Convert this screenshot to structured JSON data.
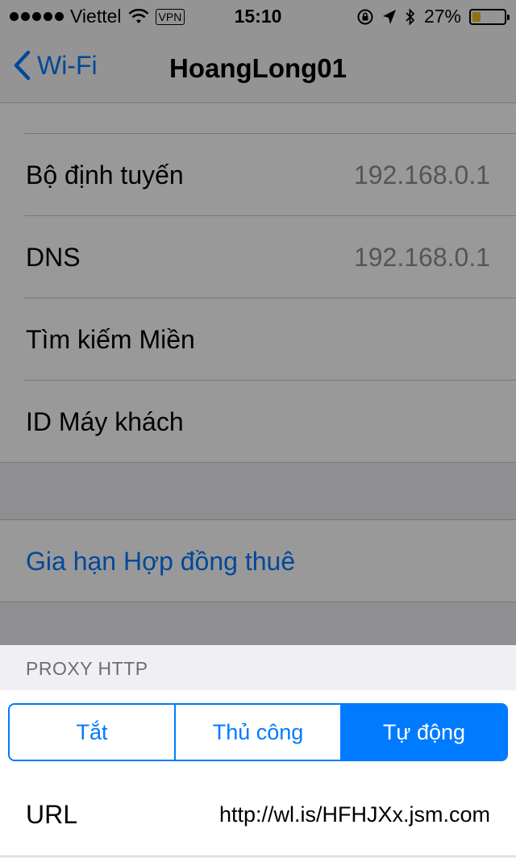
{
  "status_bar": {
    "carrier": "Viettel",
    "vpn": "VPN",
    "time": "15:10",
    "battery": "27%",
    "battery_level": 0.27
  },
  "nav": {
    "back_label": "Wi-Fi",
    "title": "HoangLong01"
  },
  "rows": [
    {
      "label": "Bộ định tuyến",
      "value": "192.168.0.1"
    },
    {
      "label": "DNS",
      "value": "192.168.0.1"
    },
    {
      "label": "Tìm kiếm Miền",
      "value": ""
    },
    {
      "label": "ID Máy khách",
      "value": ""
    }
  ],
  "renew_lease": "Gia hạn Hợp đồng thuê",
  "proxy": {
    "header": "PROXY HTTP",
    "options": [
      "Tắt",
      "Thủ công",
      "Tự động"
    ],
    "selected": "Tự động",
    "url_label": "URL",
    "url_value": "http://wl.is/HFHJXx.jsm.com"
  },
  "colors": {
    "accent": "#007aff",
    "battery": "#e8c020"
  }
}
